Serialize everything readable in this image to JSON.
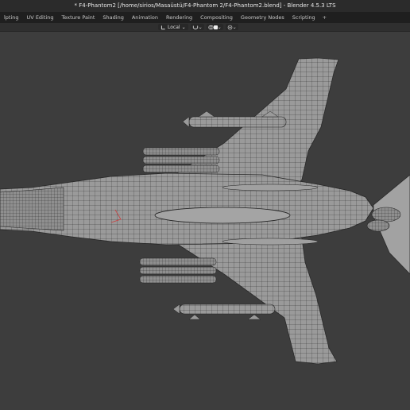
{
  "window": {
    "title": "* F4-Phantom2 [/home/sirios/Masaüstü/F4-Phantom 2/F4-Phantom2.blend] - Blender 4.5.3 LTS"
  },
  "workspace_tabs": [
    {
      "label": "lpting",
      "active": false
    },
    {
      "label": "UV Editing",
      "active": false
    },
    {
      "label": "Texture Paint",
      "active": false
    },
    {
      "label": "Shading",
      "active": false
    },
    {
      "label": "Animation",
      "active": false
    },
    {
      "label": "Rendering",
      "active": false
    },
    {
      "label": "Compositing",
      "active": false
    },
    {
      "label": "Geometry Nodes",
      "active": false
    },
    {
      "label": "Scripting",
      "active": false
    }
  ],
  "add_tab_label": "+",
  "viewport_header": {
    "pivot_label": "Local",
    "pivot_icon": "transform-orientation-icon",
    "dropdown_glyph": "⌄"
  },
  "colors": {
    "viewport_bg": "#3d3d3d",
    "titlebar_bg": "#2b2b2b",
    "tabbar_bg": "#1f1f1f",
    "active_tab_bg": "#3a3a3a",
    "mesh_fill": "#9a9a9a",
    "wireframe": "#202020"
  }
}
